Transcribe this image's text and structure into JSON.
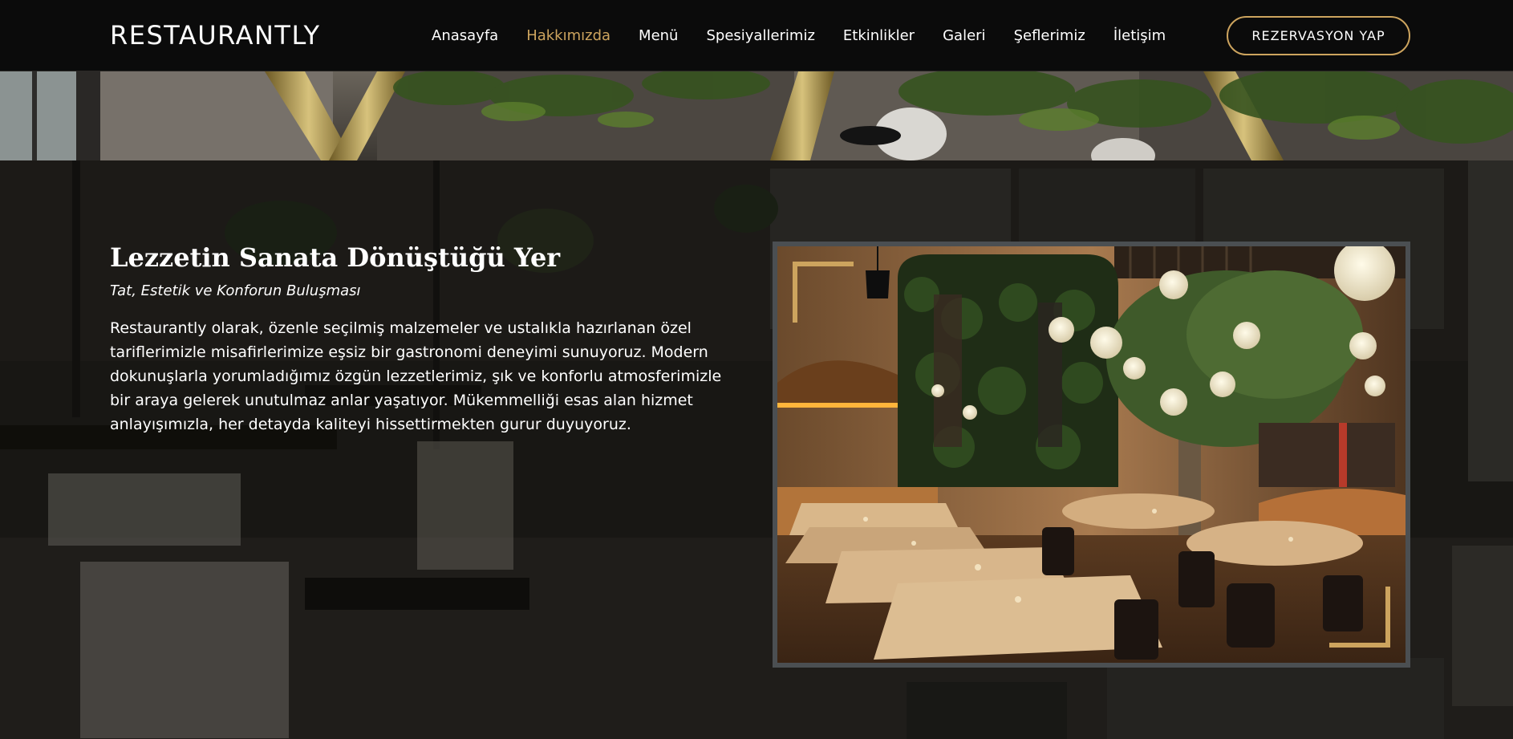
{
  "brand": {
    "logo_text": "RESTAURANTLY"
  },
  "nav": {
    "items": [
      {
        "label": "Anasayfa",
        "active": false
      },
      {
        "label": "Hakkımızda",
        "active": true
      },
      {
        "label": "Menü",
        "active": false
      },
      {
        "label": "Spesiyallerimiz",
        "active": false
      },
      {
        "label": "Etkinlikler",
        "active": false
      },
      {
        "label": "Galeri",
        "active": false
      },
      {
        "label": "Şeflerimiz",
        "active": false
      },
      {
        "label": "İletişim",
        "active": false
      }
    ],
    "cta_label": "REZERVASYON YAP"
  },
  "about": {
    "title": "Lezzetin Sanata Dönüştüğü Yer",
    "subtitle": "Tat, Estetik ve Konforun Buluşması",
    "description": "Restaurantly olarak, özenle seçilmiş malzemeler ve ustalıkla hazırlanan özel tariflerimizle misafirlerimize eşsiz bir gastronomi deneyimi sunuyoruz. Modern dokunuşlarla yorumladığımız özgün lezzetlerimiz, şık ve konforlu atmosferimizle bir araya gelerek unutulmaz anlar yaşatıyor. Mükemmelliği esas alan hizmet anlayışımızla, her detayda kaliteyi hissettirmekten gurur duyuyoruz."
  },
  "colors": {
    "accent": "#cda45e",
    "header_bg": "#0b0b0b",
    "frame_border": "#4b4f52"
  }
}
